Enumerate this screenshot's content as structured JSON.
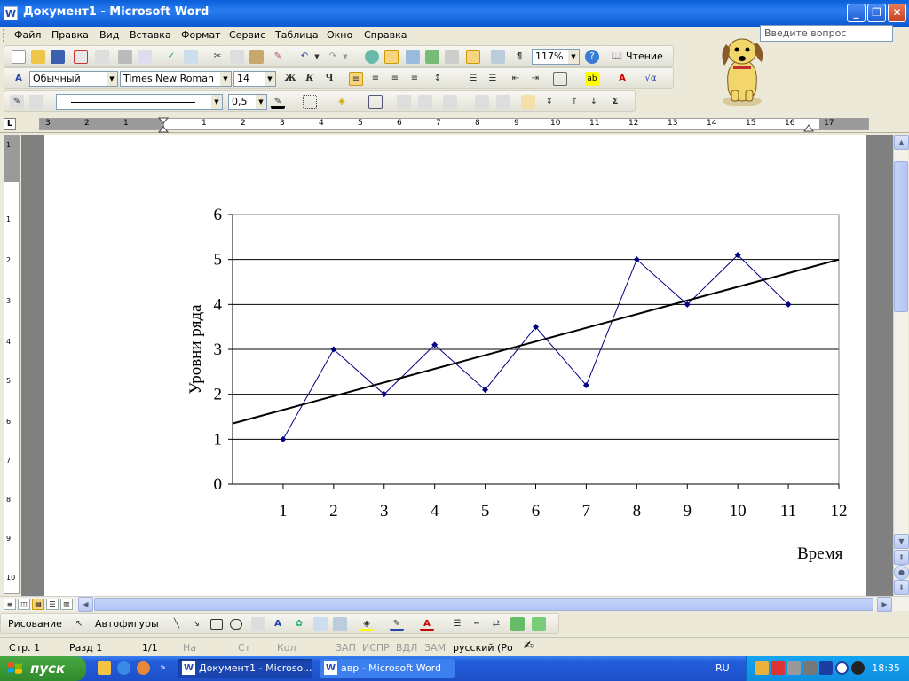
{
  "window": {
    "title": "Документ1 - Microsoft Word",
    "app_icon_letter": "W",
    "minimize_glyph": "_",
    "maximize_glyph": "❐",
    "close_glyph": "✕"
  },
  "menu": {
    "items": [
      "Файл",
      "Правка",
      "Вид",
      "Вставка",
      "Формат",
      "Сервис",
      "Таблица",
      "Окно",
      "Справка"
    ],
    "ask_placeholder": "Введите вопрос"
  },
  "standard_toolbar": {
    "zoom": "117%",
    "reading_label": "Чтение"
  },
  "formatting_toolbar": {
    "style": "Обычный",
    "font": "Times New Roman",
    "size": "14",
    "bold": "Ж",
    "italic": "К",
    "underline": "Ч"
  },
  "tables_toolbar": {
    "line_weight": "0,5"
  },
  "ruler": {
    "tab_selector": "L",
    "labels": [
      "3",
      "2",
      "1",
      "1",
      "2",
      "3",
      "4",
      "5",
      "6",
      "7",
      "8",
      "9",
      "10",
      "11",
      "12",
      "13",
      "14",
      "15",
      "16",
      "17"
    ],
    "vertical_labels": [
      "1",
      "1",
      "2",
      "3",
      "4",
      "5",
      "6",
      "7",
      "8",
      "9",
      "10"
    ]
  },
  "chart_data": {
    "type": "line",
    "title": "",
    "xlabel": "Время",
    "ylabel": "Уровни ряда",
    "x": [
      1,
      2,
      3,
      4,
      5,
      6,
      7,
      8,
      9,
      10,
      11
    ],
    "values": [
      1,
      3,
      2,
      3.1,
      2.1,
      3.5,
      2.2,
      5,
      4,
      5.1,
      4
    ],
    "x_ticks": [
      "1",
      "2",
      "3",
      "4",
      "5",
      "6",
      "7",
      "8",
      "9",
      "10",
      "11",
      "12"
    ],
    "y_ticks": [
      "0",
      "1",
      "2",
      "3",
      "4",
      "5",
      "6"
    ],
    "xlim": [
      0,
      12
    ],
    "ylim": [
      0,
      6
    ],
    "grid": "horizontal",
    "trendline": {
      "start": [
        0,
        1.35
      ],
      "end": [
        12,
        5.0
      ]
    },
    "series_color": "#000080",
    "trend_color": "#000000"
  },
  "drawing_toolbar": {
    "drawing_label": "Рисование",
    "autoshapes_label": "Автофигуры"
  },
  "status": {
    "page": "Стр. 1",
    "section": "Разд 1",
    "pages": "1/1",
    "at": "На",
    "line": "Ст",
    "col": "Кол",
    "rec": "ЗАП",
    "trk": "ИСПР",
    "ext": "ВДЛ",
    "ovr": "ЗАМ",
    "language": "русский (Ро"
  },
  "taskbar": {
    "start_label": "пуск",
    "tasks": [
      "Документ1 - Microso...",
      "авр - Microsoft Word"
    ],
    "language": "RU",
    "clock": "18:35"
  }
}
